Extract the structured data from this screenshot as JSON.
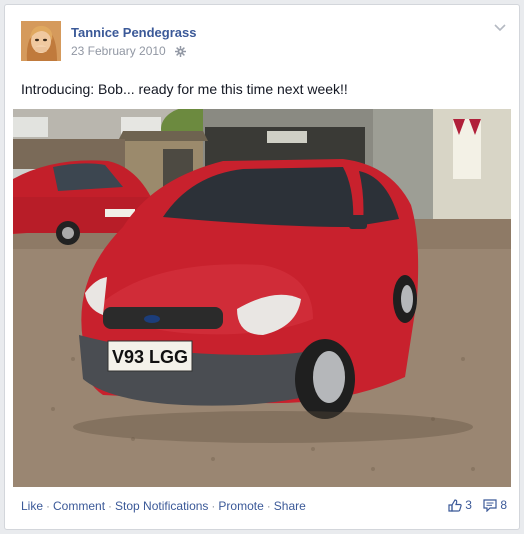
{
  "post": {
    "author": "Tannice Pendegrass",
    "date": "23 February 2010",
    "text": "Introducing: Bob... ready for me this time next week!!",
    "plate": "V93 LGG"
  },
  "footer": {
    "like": "Like",
    "comment": "Comment",
    "stop_notifications": "Stop Notifications",
    "promote": "Promote",
    "share": "Share",
    "separator": "·",
    "likes_count": "3",
    "comments_count": "8"
  },
  "icons": {
    "privacy": "gear-icon",
    "options": "chevron-down-icon",
    "likes": "thumbs-up-icon",
    "comments": "comment-icon"
  },
  "colors": {
    "link": "#3b5998",
    "muted": "#9197a3",
    "car": "#c8212d"
  }
}
